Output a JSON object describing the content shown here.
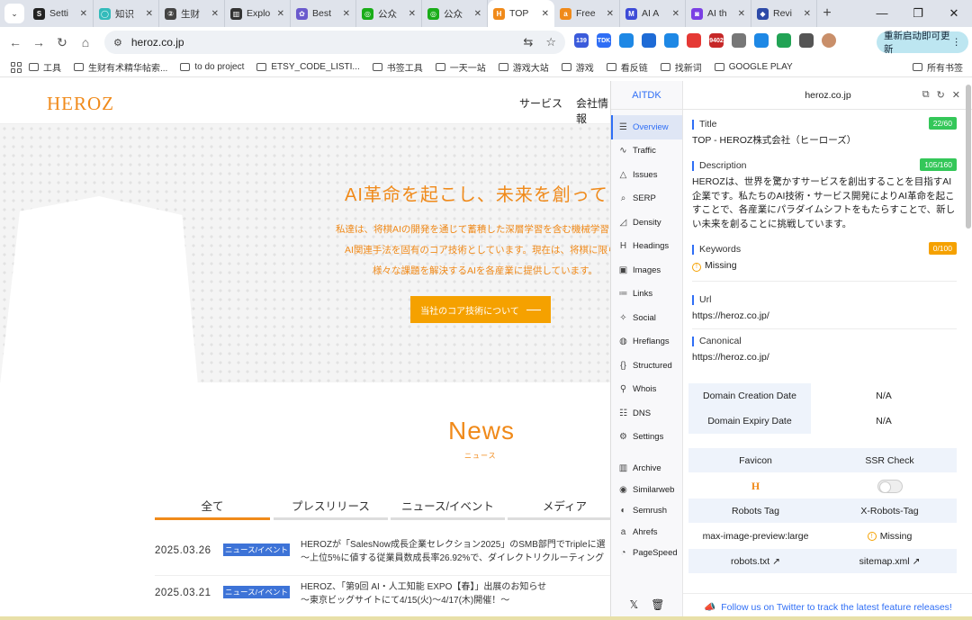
{
  "browser": {
    "tabs": [
      {
        "title": "Setti",
        "color": "#222",
        "glyph": "S"
      },
      {
        "title": "知识",
        "color": "#3bb",
        "glyph": "◯"
      },
      {
        "title": "生财",
        "color": "#444",
        "glyph": "②"
      },
      {
        "title": "Explo",
        "color": "#333",
        "glyph": "▥"
      },
      {
        "title": "Best",
        "color": "#6a5acd",
        "glyph": "✿"
      },
      {
        "title": "公众",
        "color": "#1aad19",
        "glyph": "◎"
      },
      {
        "title": "公众",
        "color": "#1aad19",
        "glyph": "◎"
      },
      {
        "title": "TOP",
        "color": "#f08a1a",
        "glyph": "H"
      },
      {
        "title": "Free",
        "color": "#f08a1a",
        "glyph": "a"
      },
      {
        "title": "AI A",
        "color": "#3d4bd7",
        "glyph": "M"
      },
      {
        "title": "AI th",
        "color": "#7b3fe4",
        "glyph": "◙"
      },
      {
        "title": "Revi",
        "color": "#2d4aa8",
        "glyph": "◆"
      }
    ],
    "active_tab_index": 7,
    "new_tab": "+",
    "url": "heroz.co.jp",
    "update_button": "重新启动即可更新",
    "extensions": [
      {
        "name": "calendar-ext-icon",
        "color": "#3b5bdb",
        "badge": "139"
      },
      {
        "name": "tdk-ext-icon",
        "color": "#2f6ef5",
        "badge": "TDK"
      },
      {
        "name": "cloud-ext-icon",
        "color": "#1e88e5",
        "badge": ""
      },
      {
        "name": "c-ext-icon",
        "color": "#1e6bd6",
        "badge": ""
      },
      {
        "name": "puzzle-ext-icon",
        "color": "#1e88e5",
        "badge": ""
      },
      {
        "name": "chrome-ext-icon",
        "color": "#e53935",
        "badge": ""
      },
      {
        "name": "counter-ext-icon",
        "color": "#c62828",
        "badge": "9402"
      },
      {
        "name": "caption-ext-icon",
        "color": "#777",
        "badge": ""
      },
      {
        "name": "drive-ext-icon",
        "color": "#1e88e5",
        "badge": ""
      },
      {
        "name": "a-ext-icon",
        "color": "#22a355",
        "badge": ""
      },
      {
        "name": "extensions-icon",
        "color": "#555",
        "badge": ""
      }
    ],
    "bookmarks": [
      "工具",
      "生财有术精华帖索...",
      "to do project",
      "ETSY_CODE_LISTI...",
      "书签工具",
      "一天一站",
      "游戏大站",
      "游戏",
      "看反链",
      "找新词",
      "GOOGLE PLAY"
    ],
    "all_bookmarks": "所有书签"
  },
  "site": {
    "logo": "HEROZ",
    "nav": [
      "サービス",
      "会社情報"
    ],
    "hero_title": "AI革命を起こし、未来を創っていく",
    "hero_lines": [
      "私達は、将棋AIの開発を通じて蓄積した深層学習を含む機械学習に",
      "AI関連手法を固有のコア技術としています。現在は、将棋に限ら",
      "様々な課題を解決するAIを各産業に提供しています。"
    ],
    "cta": "当社のコア技術について",
    "news_title": "News",
    "news_sub": "ニュース",
    "news_tabs": [
      "全て",
      "プレスリリース",
      "ニュース/イベント",
      "メディア"
    ],
    "news": [
      {
        "date": "2025.03.26",
        "badge": "ニュース/イベント",
        "line1": "HEROZが「SalesNow成長企業セレクション2025」のSMB部門でTripleに選",
        "line2": "〜上位5%に値する従業員数成長率26.92%で、ダイレクトリクルーティング"
      },
      {
        "date": "2025.03.21",
        "badge": "ニュース/イベント",
        "line1": "HEROZ、「第9回 AI・人工知能 EXPO【春】」出展のお知らせ",
        "line2": "〜東京ビッグサイトにて4/15(火)〜4/17(木)開催！〜"
      }
    ]
  },
  "aitdk": {
    "brand": "AITDK",
    "domain": "heroz.co.jp",
    "nav": [
      {
        "label": "Overview",
        "icon": "☰"
      },
      {
        "label": "Traffic",
        "icon": "∿"
      },
      {
        "label": "Issues",
        "icon": "△"
      },
      {
        "label": "SERP",
        "icon": "⌕"
      },
      {
        "label": "Density",
        "icon": "◿"
      },
      {
        "label": "Headings",
        "icon": "H"
      },
      {
        "label": "Images",
        "icon": "▣"
      },
      {
        "label": "Links",
        "icon": "≔"
      },
      {
        "label": "Social",
        "icon": "✧"
      },
      {
        "label": "Hreflangs",
        "icon": "◍"
      },
      {
        "label": "Structured",
        "icon": "{}"
      },
      {
        "label": "Whois",
        "icon": "⚲"
      },
      {
        "label": "DNS",
        "icon": "☷"
      },
      {
        "label": "Settings",
        "icon": "⚙"
      }
    ],
    "nav2": [
      {
        "label": "Archive",
        "icon": "▥"
      },
      {
        "label": "Similarweb",
        "icon": "◉"
      },
      {
        "label": "Semrush",
        "icon": "◐"
      },
      {
        "label": "Ahrefs",
        "icon": "a"
      },
      {
        "label": "PageSpeed",
        "icon": "◔"
      }
    ],
    "title_label": "Title",
    "title_count": "22/60",
    "title_value": "TOP - HEROZ株式会社（ヒーローズ）",
    "desc_label": "Description",
    "desc_count": "105/160",
    "desc_value": "HEROZは、世界を驚かすサービスを創出することを目指すAI企業です。私たちのAI技術・サービス開発によりAI革命を起こすことで、各産業にパラダイムシフトをもたらすことで、新しい未来を創ることに挑戦しています。",
    "kw_label": "Keywords",
    "kw_count": "0/100",
    "kw_value": "Missing",
    "url_label": "Url",
    "url_value": "https://heroz.co.jp/",
    "canon_label": "Canonical",
    "canon_value": "https://heroz.co.jp/",
    "domain_creation_label": "Domain Creation Date",
    "domain_creation_value": "N/A",
    "domain_expiry_label": "Domain Expiry Date",
    "domain_expiry_value": "N/A",
    "favicon_label": "Favicon",
    "favicon_glyph": "H",
    "ssr_label": "SSR Check",
    "robots_tag_label": "Robots Tag",
    "robots_tag_value": "max-image-preview:large",
    "x_robots_label": "X-Robots-Tag",
    "x_robots_value": "Missing",
    "robots_txt": "robots.txt",
    "sitemap": "sitemap.xml",
    "follow_note": "Follow us on Twitter to track the latest feature releases!",
    "colors": {
      "green": "#34c759",
      "orange": "#f5a100",
      "accent": "#2f6ef5"
    }
  }
}
